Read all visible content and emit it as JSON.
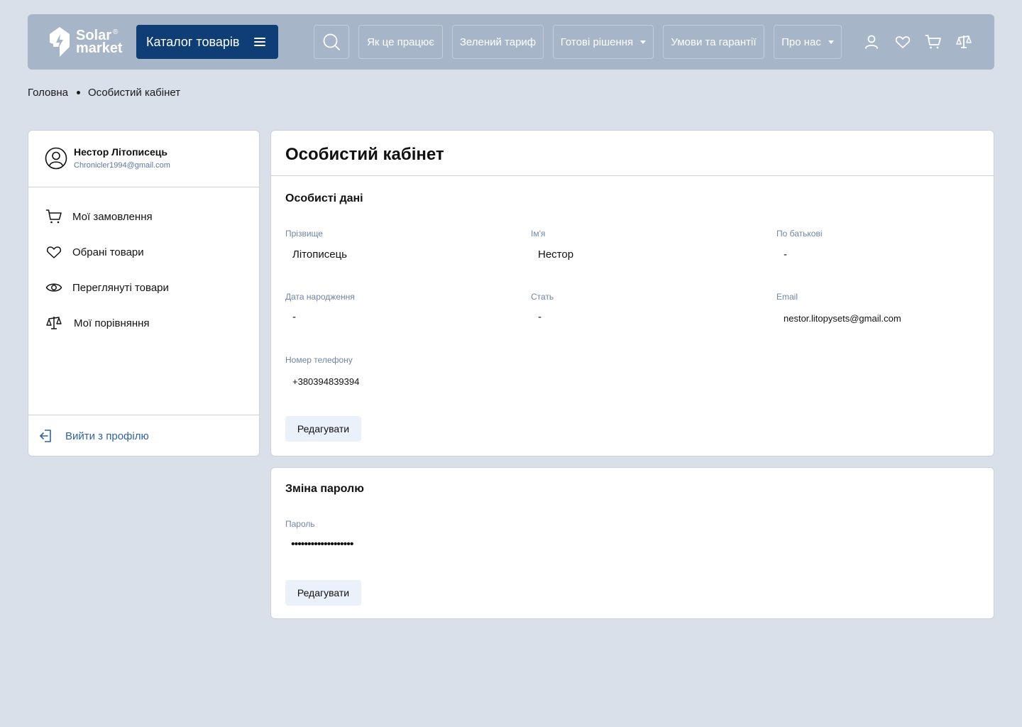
{
  "header": {
    "logo": {
      "line1": "Solar",
      "line2": "market",
      "reg": "®"
    },
    "catalog_label": "Каталог товарів",
    "nav": [
      {
        "label": "Як це працює"
      },
      {
        "label": "Зелений тариф"
      },
      {
        "label": "Готові рішення"
      },
      {
        "label": "Умови та гарантії"
      },
      {
        "label": "Про нас"
      }
    ],
    "icons": [
      "search-icon",
      "user-icon",
      "heart-icon",
      "cart-icon",
      "compare-scales-icon"
    ]
  },
  "breadcrumb": {
    "home": "Головна",
    "current": "Особистий кабінет"
  },
  "sidebar": {
    "user_name": "Нестор Літописець",
    "user_email": "Chronicler1994@gmail.com",
    "items": [
      {
        "label": "Мої замовлення",
        "icon": "cart-icon"
      },
      {
        "label": "Обрані товари",
        "icon": "heart-icon"
      },
      {
        "label": "Переглянуті товари",
        "icon": "eye-icon"
      },
      {
        "label": "Мої порівняння",
        "icon": "compare-scales-icon"
      }
    ],
    "logout_label": "Вийти з профілю"
  },
  "main": {
    "title": "Особистий кабінет",
    "personal": {
      "section_title": "Особисті дані",
      "fields": {
        "surname": {
          "label": "Прізвище",
          "value": "Літописець"
        },
        "name": {
          "label": "Ім'я",
          "value": "Нестор"
        },
        "patronymic": {
          "label": "По батькові",
          "value": "-"
        },
        "birthdate": {
          "label": "Дата народження",
          "value": "-"
        },
        "gender": {
          "label": "Стать",
          "value": "-"
        },
        "email": {
          "label": "Email",
          "value": "nestor.litopysets@gmail.com"
        },
        "phone": {
          "label": "Номер телефону",
          "value": "+380394839394"
        }
      },
      "edit_label": "Редагувати"
    },
    "password": {
      "section_title": "Зміна паролю",
      "label": "Пароль",
      "value": "•••••••••••••••••••",
      "edit_label": "Редагувати"
    }
  },
  "colors": {
    "background": "#d9e0ea",
    "header": "#a6b5c8",
    "catalog_button": "#0f3e76",
    "link": "#2e63a8",
    "label": "#6f86a6",
    "edit_button": "#eaf1fa"
  }
}
